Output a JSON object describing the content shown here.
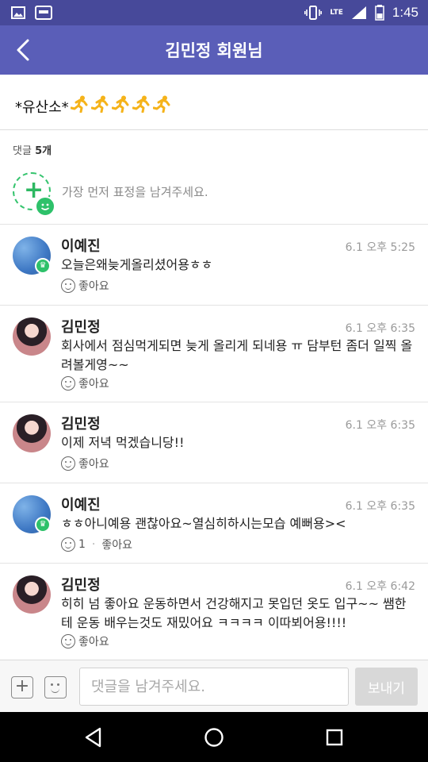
{
  "status_bar": {
    "time": "1:45",
    "network": "LTE",
    "icons": [
      "picture-icon",
      "band-notification-icon",
      "vibrate-icon",
      "signal-icon",
      "battery-icon"
    ],
    "background": "#47499a"
  },
  "app_bar": {
    "title": "김민정 회원님",
    "back_icon": "chevron-left-icon",
    "background": "#5a5eb8"
  },
  "post": {
    "title": "*유산소*",
    "emoji_icon": "running-person-icon",
    "emoji_count": 5
  },
  "comments_section": {
    "count_label": "댓글",
    "count": "5개",
    "first_emotion_prompt": "가장 먼저 표정을 남겨주세요.",
    "accent_color": "#2ec16a"
  },
  "comments": [
    {
      "author": "이예진",
      "time": "6.1 오후 5:25",
      "text": "오늘은왜늦게올리셨어용ㅎㅎ",
      "like_label": "좋아요",
      "like_count": "",
      "avatar": "blue",
      "crown": true
    },
    {
      "author": "김민정",
      "time": "6.1 오후 6:35",
      "text": "회사에서 점심먹게되면 늦게 올리게 되네용 ㅠ 담부턴 좀더 일찍 올려볼게영~~",
      "like_label": "좋아요",
      "like_count": "",
      "avatar": "photo",
      "crown": false
    },
    {
      "author": "김민정",
      "time": "6.1 오후 6:35",
      "text": "이제 저녁 먹겠습니당!!",
      "like_label": "좋아요",
      "like_count": "",
      "avatar": "photo",
      "crown": false
    },
    {
      "author": "이예진",
      "time": "6.1 오후 6:35",
      "text": "ㅎㅎ아니예용 괜찮아요~열심히하시는모습 예뻐용><",
      "like_label": "좋아요",
      "like_count": "1",
      "avatar": "blue",
      "crown": true
    },
    {
      "author": "김민정",
      "time": "6.1 오후 6:42",
      "text": "히히 넘 좋아요 운동하면서 건강해지고 못입던 옷도 입구~~ 쌤한테 운동 배우는것도 재밌어요 ㅋㅋㅋㅋ 이따뵈어용!!!!",
      "like_label": "좋아요",
      "like_count": "",
      "avatar": "photo",
      "crown": false
    }
  ],
  "input_bar": {
    "placeholder": "댓글을 남겨주세요.",
    "value": "",
    "send_label": "보내기"
  },
  "nav_bar": {
    "buttons": [
      "back-triangle-icon",
      "home-circle-icon",
      "recents-square-icon"
    ]
  }
}
